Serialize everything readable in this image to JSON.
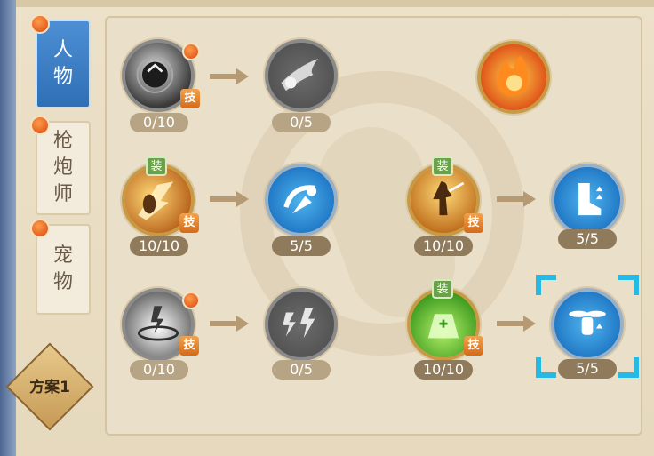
{
  "tabs": [
    {
      "line1": "人",
      "line2": "物",
      "active": true
    },
    {
      "line1": "枪",
      "line2": "炮",
      "line3": "师",
      "active": false
    },
    {
      "line1": "宠",
      "line2": "物",
      "active": false
    }
  ],
  "plan_label": "方案1",
  "badge_skill": "技",
  "badge_equip": "装",
  "skills": {
    "r1a": {
      "count": "0/10",
      "icon": "dark-orb-icon"
    },
    "r1b": {
      "count": "0/5",
      "icon": "comet-strike-icon"
    },
    "r1c": {
      "icon": "fire-orb-icon"
    },
    "r2a": {
      "count": "10/10",
      "icon": "flame-slash-icon"
    },
    "r2b": {
      "count": "5/5",
      "icon": "whirlwind-strike-icon"
    },
    "r2c": {
      "count": "10/10",
      "icon": "warrior-fire-icon"
    },
    "r2d": {
      "count": "5/5",
      "icon": "leg-upgrade-icon"
    },
    "r3a": {
      "count": "0/10",
      "icon": "thunder-vortex-icon"
    },
    "r3b": {
      "count": "0/5",
      "icon": "lightning-bolts-icon"
    },
    "r3c": {
      "count": "10/10",
      "icon": "green-potion-icon"
    },
    "r3d": {
      "count": "5/5",
      "icon": "drone-upgrade-icon"
    }
  },
  "colors": {
    "accent": "#2f6fb5",
    "gold_ring": "#c99a45",
    "badge_orange": "#d56a17",
    "badge_green": "#6aa14a",
    "selection_cyan": "#27b9e6"
  }
}
